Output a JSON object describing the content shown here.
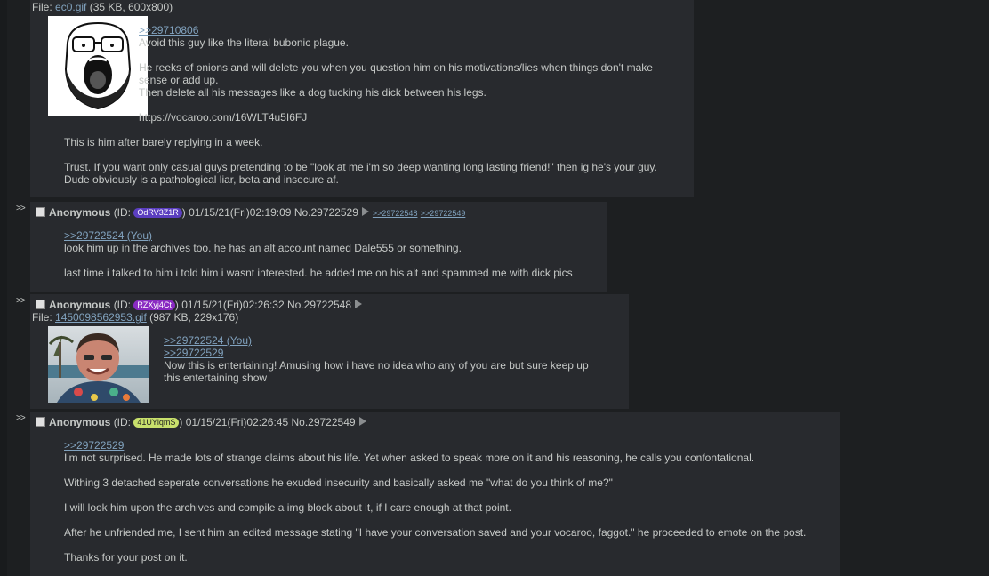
{
  "colors": {
    "page_bg": "#1d1f21",
    "post_bg": "#282a2e",
    "text": "#c5c8c6",
    "link": "#81a2be",
    "id1": "#5b3ec0",
    "id2": "#8a2bc2",
    "id3": "#c8e06c"
  },
  "posts": [
    {
      "file_label": "File: ",
      "file_name": "ec0.gif",
      "file_meta": "(35 KB, 600x800)",
      "thumb_icon": "wojak-soyjak-image",
      "reply_link": ">>29710806",
      "lines": [
        "Avoid this guy like the literal bubonic plague.",
        "",
        "He reeks of onions and will delete you when you question him on his motivations/lies when things don't make",
        "sense or add up.",
        "Then delete all his messages like a dog tucking his dick between his legs.",
        "",
        "https://vocaroo.com/16WLT4u5I6FJ",
        "",
        "This is him after barely replying in a week.",
        "",
        "Trust. If you want only casual guys pretending to be \"look at me i'm so deep wanting long lasting friend!\" then ig he's your guy.",
        "Dude obviously is a pathological liar, beta and insecure af."
      ]
    },
    {
      "arrows": ">>",
      "name": "Anonymous",
      "id_open": "(ID: ",
      "id": "OdRV3Z1R",
      "id_close": ")",
      "datetime": "01/15/21(Fri)02:19:09",
      "no": "No.29722529",
      "backlinks": [
        ">>29722548",
        ">>29722549"
      ],
      "reply_link": ">>29722524 (You)",
      "lines": [
        "look him up in the archives too. he has an alt account named Dale555 or something.",
        "",
        "last time i talked to him i told him i wasnt interested. he added me on his alt and spammed me with dick pics"
      ]
    },
    {
      "arrows": ">>",
      "name": "Anonymous",
      "id_open": "(ID: ",
      "id": "RZXyj4Ct",
      "id_close": ")",
      "datetime": "01/15/21(Fri)02:26:32",
      "no": "No.29722548",
      "file_label": "File: ",
      "file_name": "1450098562953.gif",
      "file_meta": "(987 KB, 229x176)",
      "thumb_icon": "man-photo-image",
      "reply_links": [
        ">>29722524 (You)",
        ">>29722529"
      ],
      "lines": [
        "Now this is entertaining! Amusing how i have no idea who any of you are but sure keep up",
        "this entertaining show"
      ]
    },
    {
      "arrows": ">>",
      "name": "Anonymous",
      "id_open": "(ID: ",
      "id": "41UYlqmS",
      "id_close": ")",
      "datetime": "01/15/21(Fri)02:26:45",
      "no": "No.29722549",
      "reply_link": ">>29722529",
      "lines": [
        "I'm not surprised. He made lots of strange claims about his life. Yet when asked to speak more on it and his reasoning, he calls you confontational.",
        "",
        "Withing 3 detached seperate conversations he exuded insecurity and basically asked me \"what do you think of me?\"",
        "",
        "I will look him upon the archives and compile a img block about it, if I care enough at that point.",
        "",
        "After he unfriended me, I sent him an edited message stating \"I have your conversation saved and your vocaroo, faggot.\" he proceeded to emote on the post.",
        "",
        "Thanks for your post on it."
      ]
    }
  ]
}
